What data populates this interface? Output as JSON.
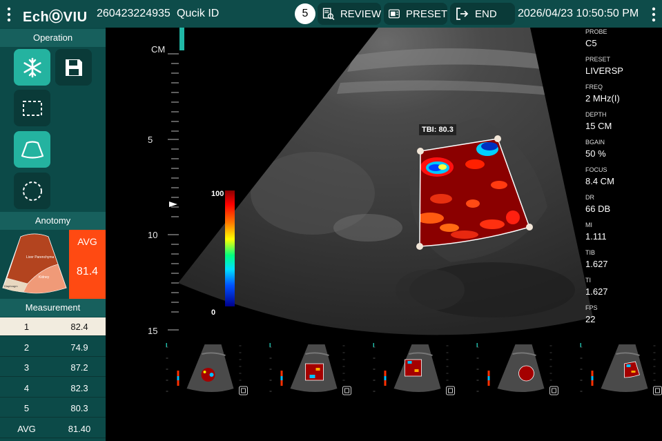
{
  "header": {
    "logo": "EchⓄVIU",
    "patient_id": "260423224935",
    "quick_id": "Qucik ID",
    "count": "5",
    "review_label": "REVIEW",
    "preset_label": "PRESET",
    "end_label": "END",
    "datetime": "2026/04/23 10:50:50 PM"
  },
  "left_panel": {
    "operation_title": "Operation",
    "operation_buttons": [
      {
        "name": "freeze",
        "icon": "snowflake-icon",
        "active": true
      },
      {
        "name": "save",
        "icon": "save-icon",
        "active": false
      },
      {
        "name": "roi-rect",
        "icon": "dashed-rectangle-icon",
        "active": false
      },
      {
        "name": "roi-sector",
        "icon": "sector-icon",
        "active": true
      },
      {
        "name": "roi-circle",
        "icon": "dashed-circle-icon",
        "active": false
      }
    ],
    "anatomy_title": "Anotomy",
    "anatomy_labels": {
      "liver": "Liver Parenchyma",
      "kidney": "Kidney",
      "diaphragm": "Diaphragm"
    },
    "avg_label": "AVG",
    "avg_value": "81.4",
    "measurement_title": "Measurement",
    "measurements": [
      {
        "n": "1",
        "v": "82.4"
      },
      {
        "n": "2",
        "v": "74.9"
      },
      {
        "n": "3",
        "v": "87.2"
      },
      {
        "n": "4",
        "v": "82.3"
      },
      {
        "n": "5",
        "v": "80.3"
      },
      {
        "n": "AVG",
        "v": "81.40"
      }
    ]
  },
  "image": {
    "depth_unit": "CM",
    "depth_ticks": [
      "5",
      "10",
      "15"
    ],
    "colorbar_max": "100",
    "colorbar_min": "0",
    "tbi_label": "TBI: 80.3"
  },
  "parameters": [
    {
      "k": "PROBE",
      "v": "C5"
    },
    {
      "k": "PRESET",
      "v": "LIVERSP"
    },
    {
      "k": "FREQ",
      "v": "2 MHz(I)"
    },
    {
      "k": "DEPTH",
      "v": "15 CM"
    },
    {
      "k": "BGAIN",
      "v": "50 %"
    },
    {
      "k": "FOCUS",
      "v": "8.4 CM"
    },
    {
      "k": "DR",
      "v": "66 DB"
    },
    {
      "k": "MI",
      "v": "1.111"
    },
    {
      "k": "TIB",
      "v": "1.627"
    },
    {
      "k": "TI",
      "v": "1.627"
    },
    {
      "k": "FPS",
      "v": "22"
    }
  ],
  "colors": {
    "topbar": "#0e4c4a",
    "accent": "#24b3a0",
    "avg": "#ff4a12",
    "selected_row": "#f2ecdf"
  }
}
